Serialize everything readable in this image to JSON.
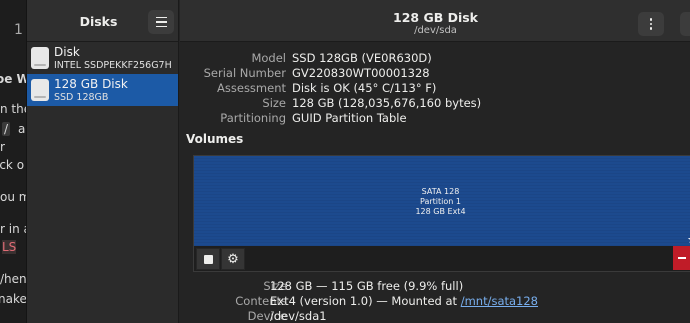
{
  "background_page": {
    "nav": "1",
    "lines": [
      "oe W",
      "n the",
      "/",
      "a",
      "r",
      "ick o",
      "ou m",
      "r in a",
      "LS",
      "/hen",
      "nake"
    ]
  },
  "sidebar": {
    "title": "Disks",
    "items": [
      {
        "name": "Disk",
        "sub": "INTEL SSDPEKKF256G7H",
        "selected": false
      },
      {
        "name": "128 GB Disk",
        "sub": "SSD 128GB",
        "selected": true
      }
    ]
  },
  "header": {
    "title": "128 GB Disk",
    "subtitle": "/dev/sda"
  },
  "drive": {
    "model_label": "Model",
    "model": "SSD 128GB (VE0R630D)",
    "serial_label": "Serial Number",
    "serial": "GV220830WT00001328",
    "assessment_label": "Assessment",
    "assessment": "Disk is OK (45° C/113° F)",
    "size_label": "Size",
    "size": "128 GB (128,035,676,160 bytes)",
    "partitioning_label": "Partitioning",
    "partitioning": "GUID Partition Table"
  },
  "volumes": {
    "heading": "Volumes",
    "partition_name": "SATA 128",
    "partition_number": "Partition 1",
    "partition_desc": "128 GB Ext4"
  },
  "volume_details": {
    "size_label": "Size",
    "size": "128 GB — 115 GB free (9.9% full)",
    "contents_label": "Contents",
    "contents_prefix": "Ext4 (version 1.0) — Mounted at ",
    "mount_link": "/mnt/sata128",
    "device_label": "Device",
    "device": "/dev/sda1"
  },
  "icons": {
    "menu": "hamburger-icon",
    "kebab": "vertical-dots-icon",
    "disk": "drive-icon",
    "stop": "stop-icon",
    "gear": "gear-icon",
    "delete": "minus-icon",
    "star": "star-icon"
  },
  "colors": {
    "accent": "#1c5aa6",
    "partition": "#1c4a8e",
    "destructive": "#c01c28",
    "link": "#78aeed"
  }
}
